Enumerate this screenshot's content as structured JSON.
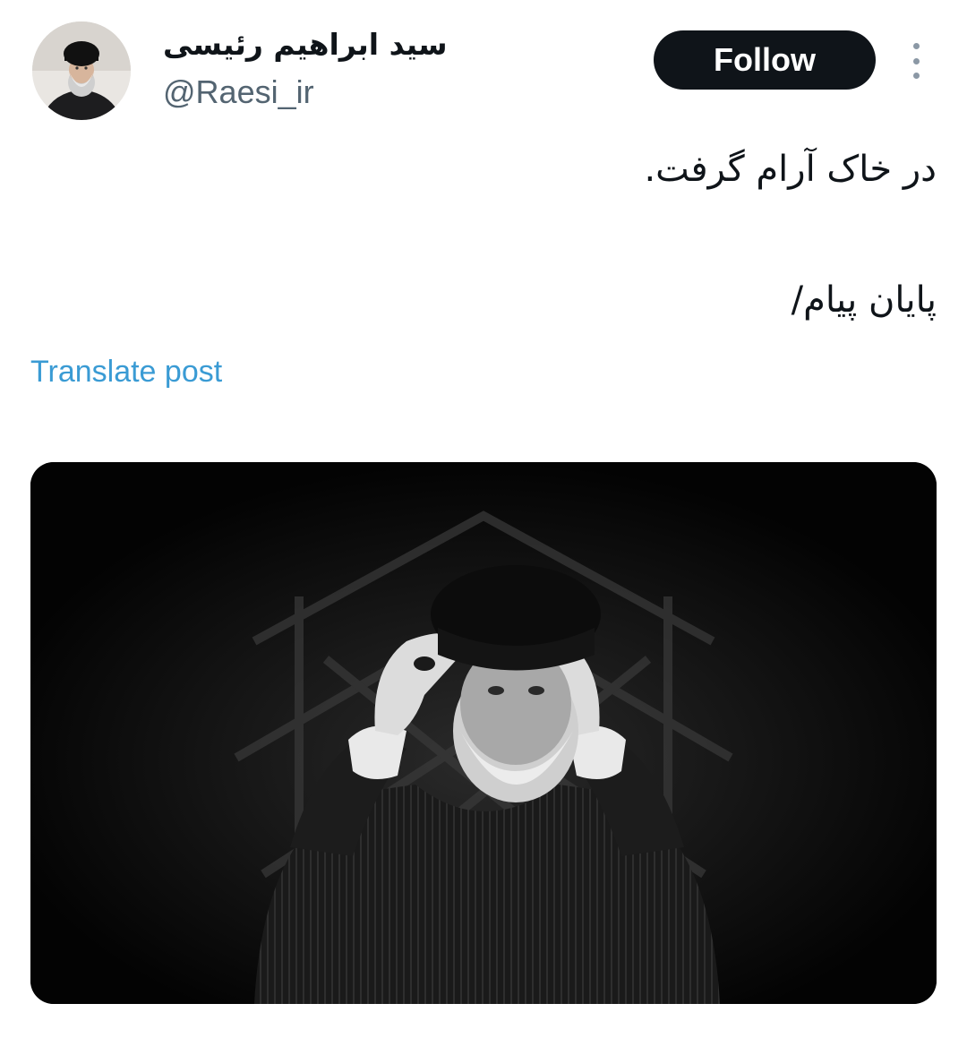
{
  "author": {
    "display_name": "سید ابراهیم رئیسی",
    "handle": "@Raesi_ir",
    "avatar_icon": "profile-photo"
  },
  "actions": {
    "follow_label": "Follow",
    "more_icon": "vertical-ellipsis-icon"
  },
  "post": {
    "lines": [
      "در خاک آرام گرفت.",
      "پایان پیام/"
    ],
    "translate_label": "Translate post"
  },
  "media": {
    "description_icon": "black-and-white-portrait-photo"
  },
  "colors": {
    "follow_bg": "#0f1419",
    "link": "#3a9bd4",
    "handle": "#536471"
  }
}
